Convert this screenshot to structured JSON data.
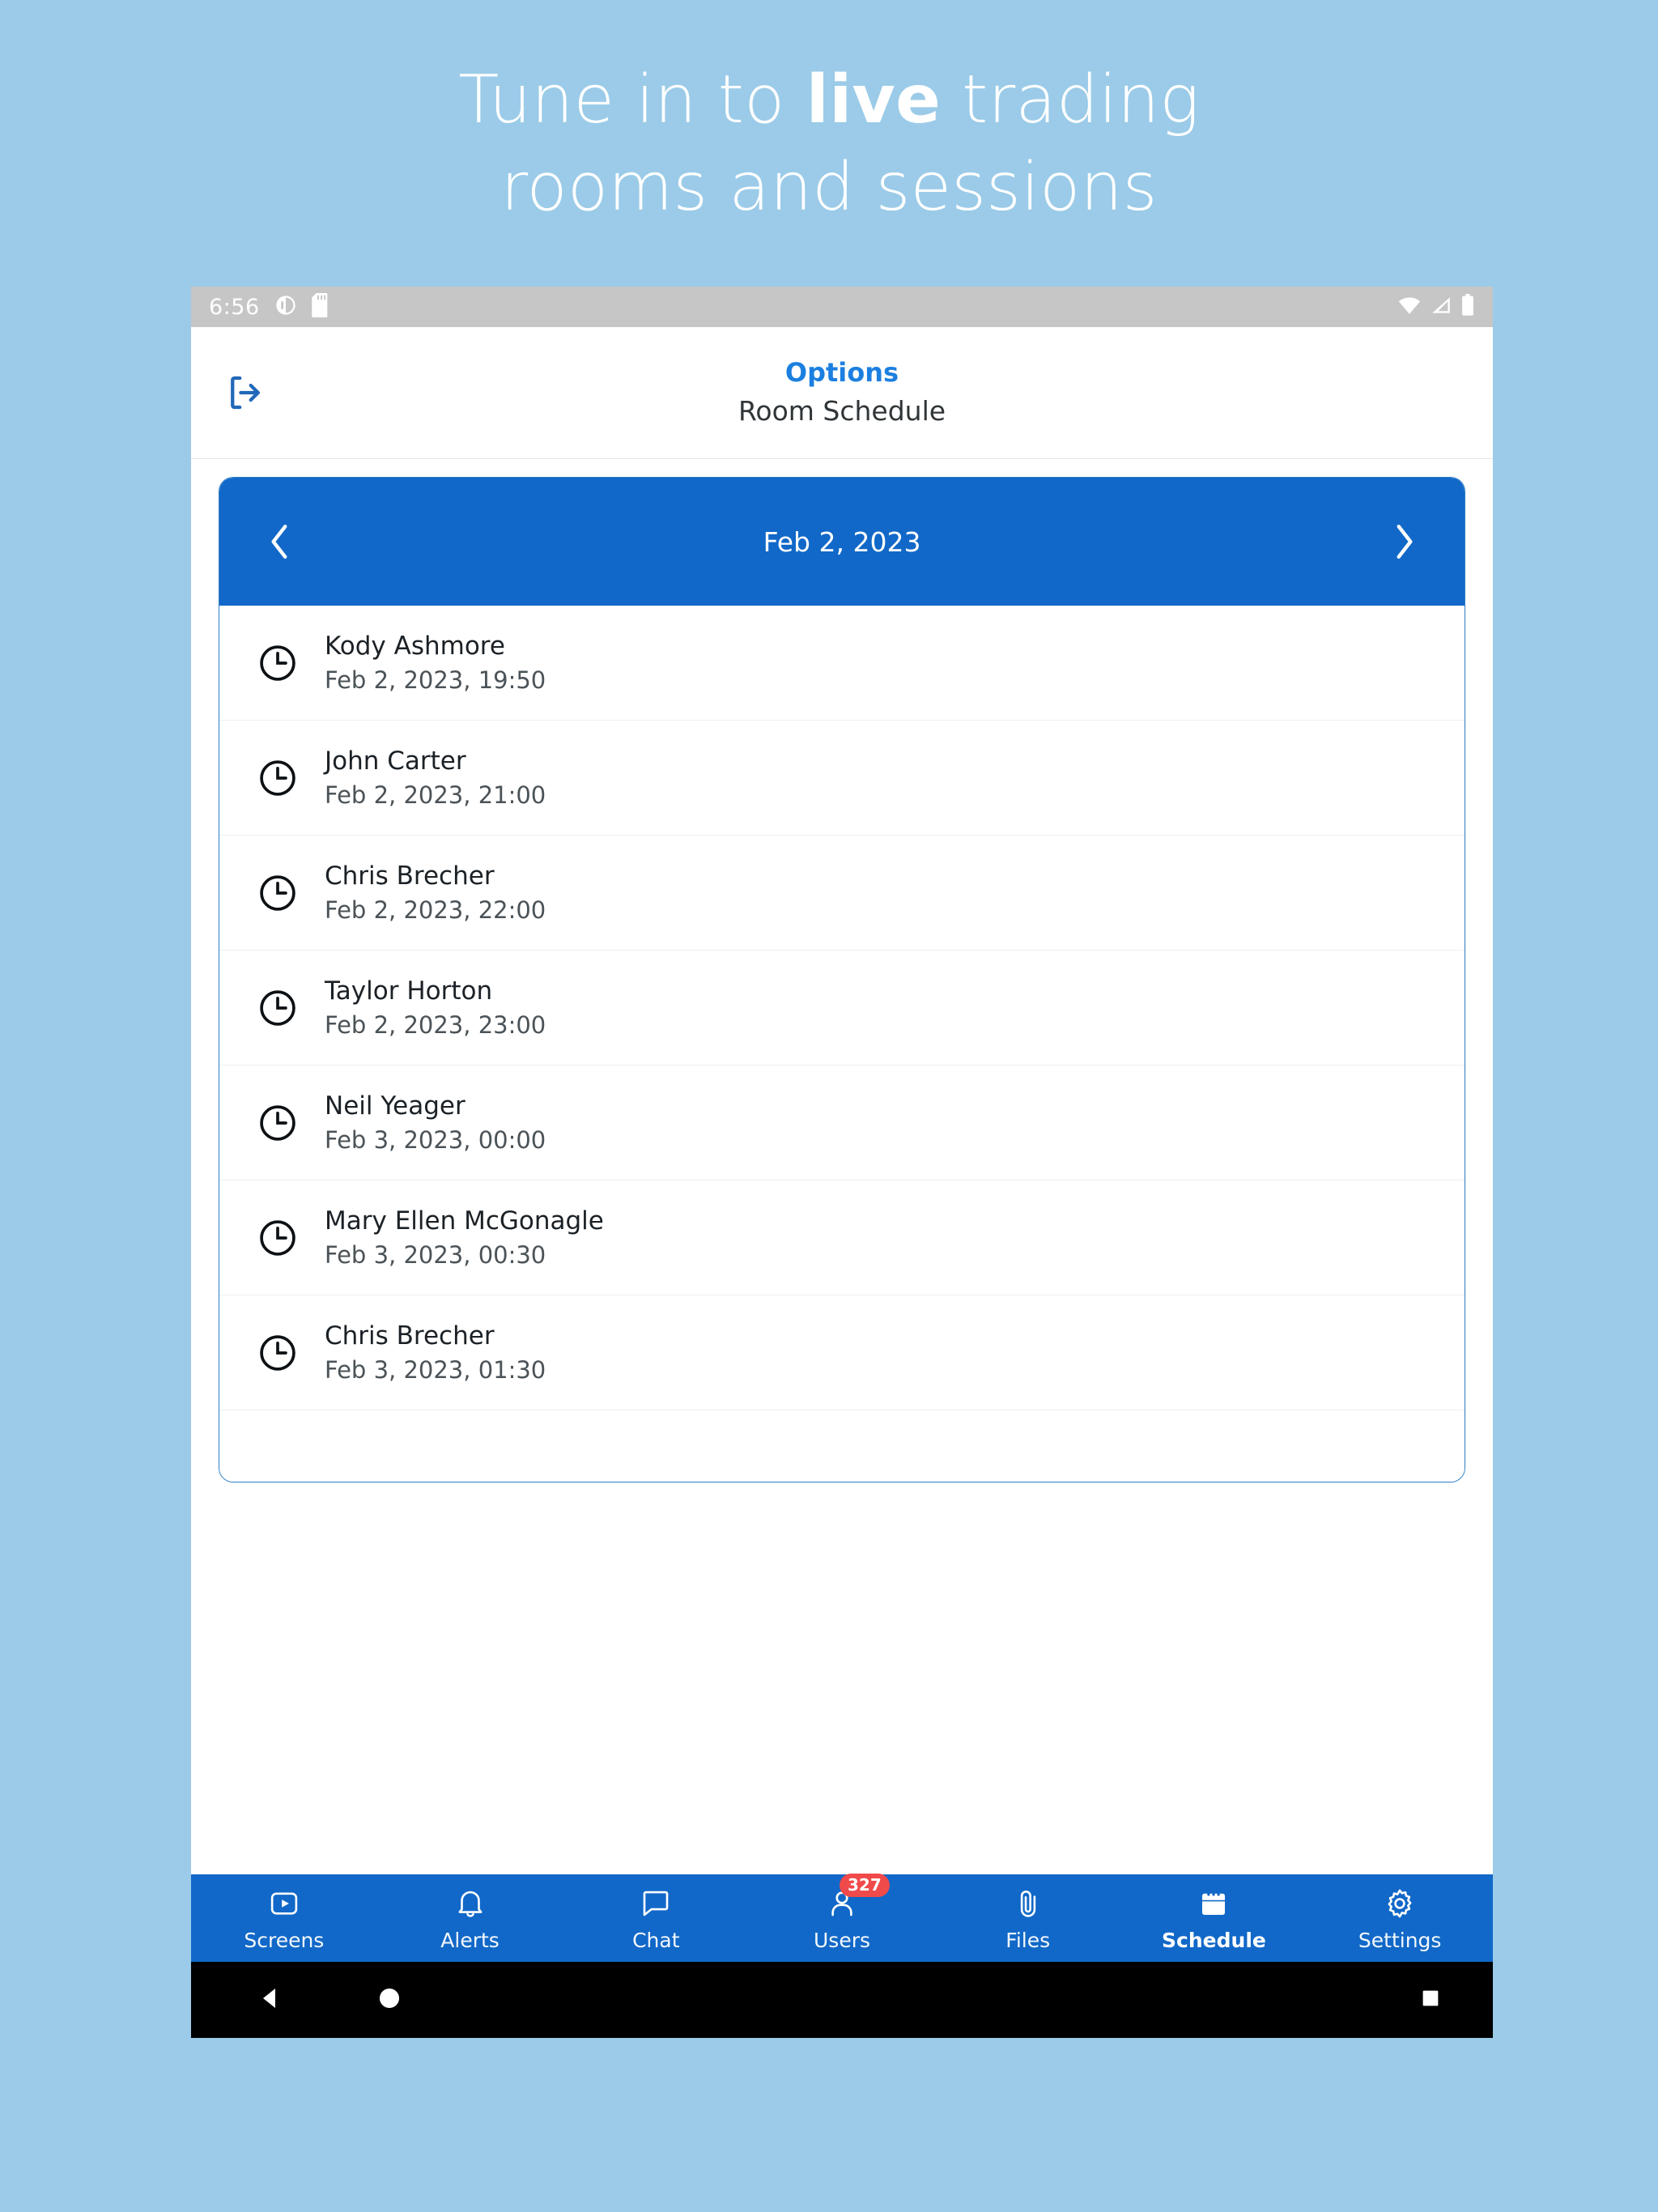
{
  "promo": {
    "line1_pre": "Tune in to ",
    "line1_bold": "live",
    "line1_post": " trading",
    "line2": "rooms and sessions",
    "bg_color": "#9BCBE8"
  },
  "status_bar": {
    "time": "6:56",
    "icons": [
      "do-not-disturb-icon",
      "sd-card-icon",
      "wifi-icon",
      "cell-signal-icon",
      "battery-icon"
    ],
    "bg_color": "#c6c6c6"
  },
  "header": {
    "back_icon": "logout-icon",
    "subtitle": "Options",
    "title": "Room Schedule",
    "accent_color": "#1C7FE0"
  },
  "date_nav": {
    "prev_icon": "chevron-left-icon",
    "next_icon": "chevron-right-icon",
    "date": "Feb 2, 2023",
    "bg_color": "#1168C8"
  },
  "schedule": {
    "rows": [
      {
        "icon": "clock-icon",
        "name": "Kody Ashmore",
        "time": "Feb 2, 2023, 19:50"
      },
      {
        "icon": "clock-icon",
        "name": "John Carter",
        "time": "Feb 2, 2023, 21:00"
      },
      {
        "icon": "clock-icon",
        "name": "Chris Brecher",
        "time": "Feb 2, 2023, 22:00"
      },
      {
        "icon": "clock-icon",
        "name": "Taylor Horton",
        "time": "Feb 2, 2023, 23:00"
      },
      {
        "icon": "clock-icon",
        "name": "Neil Yeager",
        "time": "Feb 3, 2023, 00:00"
      },
      {
        "icon": "clock-icon",
        "name": "Mary Ellen McGonagle",
        "time": "Feb 3, 2023, 00:30"
      },
      {
        "icon": "clock-icon",
        "name": "Chris Brecher",
        "time": "Feb 3, 2023, 01:30"
      }
    ]
  },
  "tabbar": {
    "bg_color": "#1168C8",
    "badge_color": "#F04A4A",
    "items": [
      {
        "label": "Screens",
        "icon": "screens-icon",
        "active": false,
        "badge": null
      },
      {
        "label": "Alerts",
        "icon": "bell-icon",
        "active": false,
        "badge": null
      },
      {
        "label": "Chat",
        "icon": "chat-icon",
        "active": false,
        "badge": null
      },
      {
        "label": "Users",
        "icon": "users-icon",
        "active": false,
        "badge": "327"
      },
      {
        "label": "Files",
        "icon": "paperclip-icon",
        "active": false,
        "badge": null
      },
      {
        "label": "Schedule",
        "icon": "calendar-icon",
        "active": true,
        "badge": null
      },
      {
        "label": "Settings",
        "icon": "gear-icon",
        "active": false,
        "badge": null
      }
    ]
  },
  "android_nav": {
    "back_icon": "nav-back-triangle-icon",
    "home_icon": "nav-home-circle-icon",
    "recent_icon": "nav-recent-square-icon"
  }
}
